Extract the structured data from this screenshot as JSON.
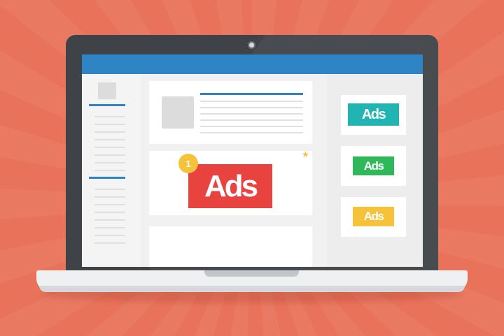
{
  "ads": {
    "main_label": "Ads",
    "rank": "1",
    "side_labels": [
      "Ads",
      "Ads",
      "Ads"
    ]
  },
  "colors": {
    "background": "#e9735a",
    "topbar": "#2f84c6",
    "main_ad": "#e8433f",
    "side_ads": [
      "#22b3b3",
      "#2fb85a",
      "#f6c23a"
    ],
    "medal": "#f6c23a"
  }
}
